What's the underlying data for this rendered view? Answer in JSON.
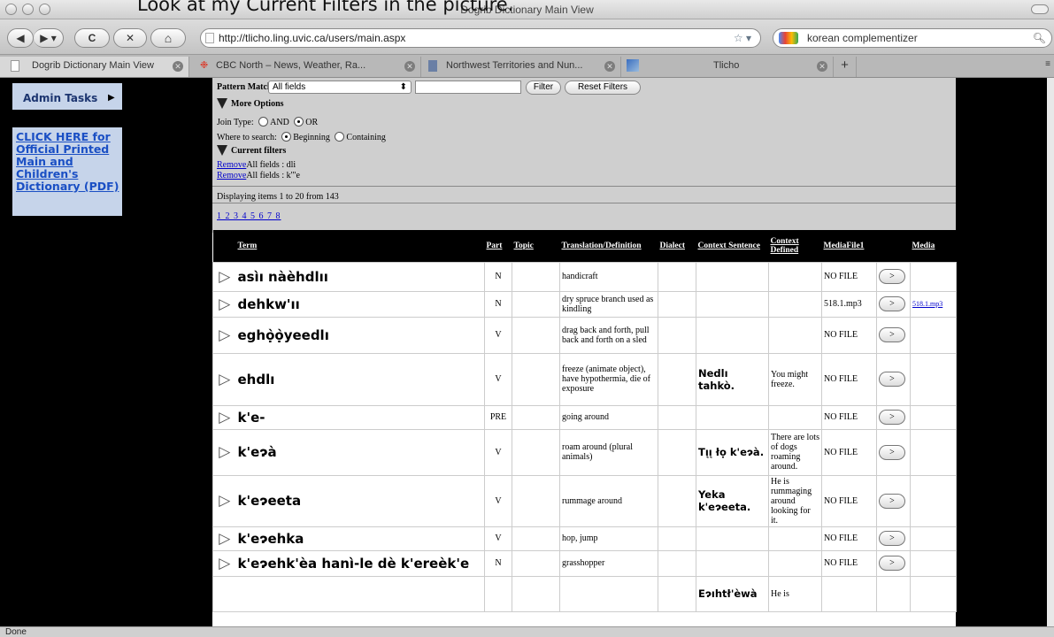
{
  "overlay_text": "Look at my Current Filters in the picture.",
  "window": {
    "title": "Dogrib Dictionary Main View"
  },
  "toolbar": {
    "back": "◀",
    "forward": "▶",
    "reload": "C",
    "stop": "✕",
    "home": "⌂",
    "url": "http://tlicho.ling.uvic.ca/users/main.aspx",
    "search_value": "korean complementizer"
  },
  "tabs": [
    {
      "label": "Dogrib Dictionary Main View"
    },
    {
      "label": "CBC North – News, Weather, Ra..."
    },
    {
      "label": "Northwest Territories and Nun..."
    },
    {
      "label": "Tlicho"
    }
  ],
  "sidebar": {
    "admin_label": "Admin Tasks",
    "official_link": "CLICK HERE for Official Printed Main and Children's Dictionary (PDF)"
  },
  "filters": {
    "pattern_label": "Pattern Match:",
    "pattern_value": "All fields",
    "filter_button": "Filter",
    "reset_button": "Reset Filters",
    "more_options": "More Options",
    "join_type_label": "Join Type:",
    "join_and": "AND",
    "join_or": "OR",
    "where_label": "Where to search:",
    "where_beginning": "Beginning",
    "where_containing": "Containing",
    "current_filters": "Current filters",
    "active": [
      {
        "remove": "Remove",
        "text": "All fields : dli"
      },
      {
        "remove": "Remove",
        "text": "All fields : k'\"e"
      }
    ],
    "displaying": "Displaying items 1 to 20 from 143",
    "pages": "1 2 3 4 5 6 7 8"
  },
  "table": {
    "headers": [
      "Term",
      "Part",
      "Topic",
      "Translation/Definition",
      "Dialect",
      "Context Sentence",
      "Context Defined",
      "MediaFile1",
      "",
      "Media"
    ],
    "rows": [
      {
        "term": "asìı nàèhdlıı",
        "part": "N",
        "topic": "",
        "def": "handicraft",
        "dialect": "",
        "ctx": "",
        "ctxdef": "",
        "file": "NO FILE",
        "play": ">",
        "media": ""
      },
      {
        "term": "dehkw'ıı",
        "part": "N",
        "topic": "",
        "def": "dry spruce branch used as kindling",
        "dialect": "",
        "ctx": "",
        "ctxdef": "",
        "file": "518.1.mp3",
        "play": ">",
        "media": "518.1.mp3"
      },
      {
        "term": "eghọ̀ọ̀yeedlı",
        "part": "V",
        "topic": "",
        "def": "drag back and forth, pull back and forth on a sled",
        "dialect": "",
        "ctx": "",
        "ctxdef": "",
        "file": "NO FILE",
        "play": ">",
        "media": ""
      },
      {
        "term": "ehdlı",
        "part": "V",
        "topic": "",
        "def": "freeze (animate object), have hypothermia, die of exposure",
        "dialect": "",
        "ctx": "Nedlı tahkò.",
        "ctxdef": "You might freeze.",
        "file": "NO FILE",
        "play": ">",
        "media": ""
      },
      {
        "term": "k'e-",
        "part": "PRE",
        "topic": "",
        "def": "going around",
        "dialect": "",
        "ctx": "",
        "ctxdef": "",
        "file": "NO FILE",
        "play": ">",
        "media": ""
      },
      {
        "term": "k'eɂà",
        "part": "V",
        "topic": "",
        "def": "roam around (plural animals)",
        "dialect": "",
        "ctx": "Tı̨ı̨ łọ k'eɂà.",
        "ctxdef": "There are lots of dogs roaming around.",
        "file": "NO FILE",
        "play": ">",
        "media": ""
      },
      {
        "term": "k'eɂeeta",
        "part": "V",
        "topic": "",
        "def": "rummage around",
        "dialect": "",
        "ctx": "Yeka k'eɂeeta.",
        "ctxdef": "He is rummaging around looking for it.",
        "file": "NO FILE",
        "play": ">",
        "media": ""
      },
      {
        "term": "k'eɂehka",
        "part": "V",
        "topic": "",
        "def": "hop, jump",
        "dialect": "",
        "ctx": "",
        "ctxdef": "",
        "file": "NO FILE",
        "play": ">",
        "media": ""
      },
      {
        "term": "k'eɂehk'èa hanì-le dè k'ereèk'e",
        "part": "N",
        "topic": "",
        "def": "grasshopper",
        "dialect": "",
        "ctx": "",
        "ctxdef": "",
        "file": "NO FILE",
        "play": ">",
        "media": ""
      },
      {
        "term": "",
        "part": "",
        "topic": "",
        "def": "",
        "dialect": "",
        "ctx": "Eɂıhtł'èwà",
        "ctxdef": "He is",
        "file": "",
        "play": "",
        "media": ""
      }
    ]
  },
  "status": "Done"
}
